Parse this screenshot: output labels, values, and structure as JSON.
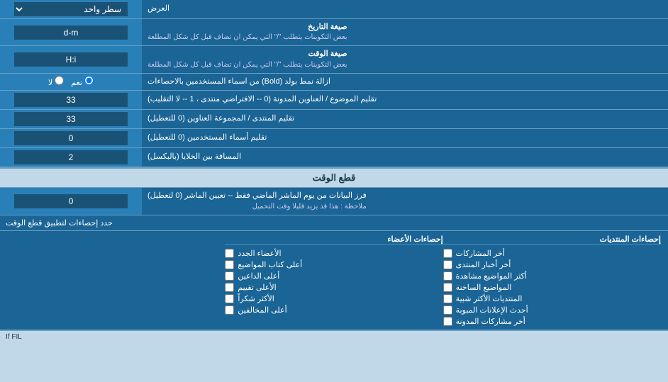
{
  "title": "العرض",
  "rows": [
    {
      "id": "display-mode",
      "label": "العرض",
      "type": "dropdown",
      "value": "سطر واحد"
    },
    {
      "id": "date-format",
      "label_main": "صيغة التاريخ",
      "label_sub": "بعض التكوينات يتطلب \"/\" التي يمكن ان تضاف قبل كل شكل المطلعة",
      "type": "text",
      "value": "d-m"
    },
    {
      "id": "time-format",
      "label_main": "صيغة الوقت",
      "label_sub": "بعض التكوينات يتطلب \"/\" التي يمكن ان تضاف قبل كل شكل المطلعة",
      "type": "text",
      "value": "H:i"
    },
    {
      "id": "bold-remove",
      "label": "ازالة نمط بولد (Bold) من اسماء المستخدمين بالاحصاءات",
      "type": "radio",
      "options": [
        "نعم",
        "لا"
      ],
      "selected": "نعم"
    },
    {
      "id": "subject-titles",
      "label": "تقليم الموضوع / العناوين المدونة (0 -- الافتراضي منتدى ، 1 -- لا التقليب)",
      "type": "text",
      "value": "33"
    },
    {
      "id": "forum-titles",
      "label": "تقليم المنتدى / المجموعة العناوين (0 للتعطيل)",
      "type": "text",
      "value": "33"
    },
    {
      "id": "usernames-trim",
      "label": "تقليم أسماء المستخدمين (0 للتعطيل)",
      "type": "text",
      "value": "0"
    },
    {
      "id": "cell-spacing",
      "label": "المسافة بين الخلايا (بالبكسل)",
      "type": "text",
      "value": "2"
    }
  ],
  "time_section": {
    "header": "قطع الوقت",
    "row": {
      "label_main": "فرز البيانات من يوم الماشر الماضي فقط -- تعيين الماشر (0 لتعطيل)",
      "label_sub": "ملاحظة : هذا قد يزيد قليلا وقت التحميل",
      "value": "0"
    },
    "limit_label": "حدد إحصاءات لتطبيق قطع الوقت"
  },
  "stats_columns": {
    "col1_header": "إحصاءات المنتديات",
    "col2_header": "إحصاءات الأعضاء",
    "col1_items": [
      "أخر المشاركات",
      "أخر أخبار المنتدى",
      "أكثر المواضيع مشاهدة",
      "المواضيع الساخنة",
      "المنتديات الأكثر شبية",
      "أحدث الإعلانات المبوبة",
      "أخر مشاركات المدونة"
    ],
    "col2_items": [
      "الأعضاء الجدد",
      "أعلى كتاب المواضيع",
      "أعلى الداعين",
      "الأعلى تقييم",
      "الأكثر شكراً",
      "أعلى المخالفين"
    ]
  },
  "bottom_note": "If FIL"
}
